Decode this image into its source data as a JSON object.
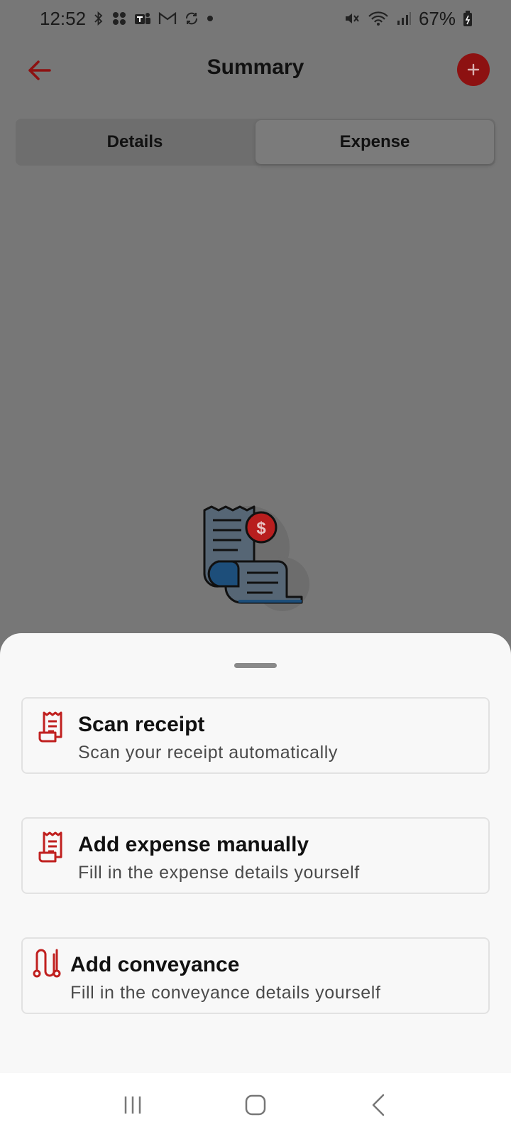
{
  "status_bar": {
    "time": "12:52",
    "battery": "67%"
  },
  "header": {
    "title": "Summary"
  },
  "tabs": [
    {
      "label": "Details"
    },
    {
      "label": "Expense"
    }
  ],
  "sheet": {
    "options": [
      {
        "title": "Scan receipt",
        "subtitle": "Scan your receipt automatically",
        "icon": "receipt-icon"
      },
      {
        "title": "Add expense manually",
        "subtitle": "Fill in the expense details yourself",
        "icon": "receipt-icon"
      },
      {
        "title": "Add conveyance",
        "subtitle": "Fill in the conveyance details yourself",
        "icon": "route-icon"
      }
    ]
  },
  "colors": {
    "accent": "#c0201f",
    "dim_background": "#777777",
    "sheet_background": "#f8f8f8"
  }
}
